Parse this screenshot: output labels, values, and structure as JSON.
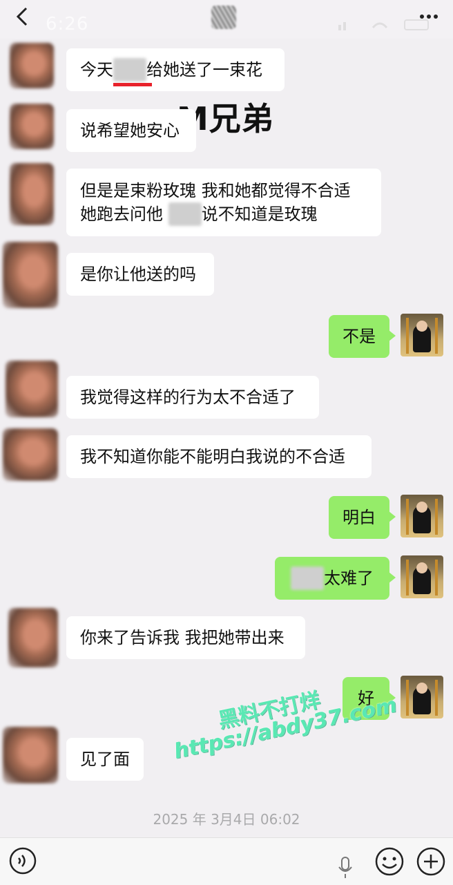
{
  "status_bar": {
    "time": "6:26"
  },
  "header": {
    "title_blurred": true
  },
  "messages": [
    {
      "side": "left",
      "pre": "今天",
      "blurred": "某某",
      "post": "给她送了一束花"
    },
    {
      "side": "left",
      "text": "说希望她安心"
    },
    {
      "side": "left",
      "line1": "但是是束粉玫瑰 我和她都觉得不合适",
      "line2_pre": "她跑去问他 ",
      "line2_blurred": "某某",
      "line2_post": "说不知道是玫瑰"
    },
    {
      "side": "left",
      "text": "是你让他送的吗"
    },
    {
      "side": "right",
      "text": "不是"
    },
    {
      "side": "left",
      "text": "我觉得这样的行为太不合适了"
    },
    {
      "side": "left",
      "text": "我不知道你能不能明白我说的不合适"
    },
    {
      "side": "right",
      "text": "明白"
    },
    {
      "side": "right",
      "blurred": "某某",
      "post": "太难了"
    },
    {
      "side": "left",
      "text": "你来了告诉我 我把她带出来"
    },
    {
      "side": "right",
      "text": "好"
    },
    {
      "side": "left",
      "text": "见了面"
    }
  ],
  "overlay": {
    "label": "M兄弟",
    "underline_color": "#e8212a"
  },
  "timestamp": "2025 年 3月4日 06:02",
  "watermark": {
    "line1": "黑料不打烊",
    "line2": "https://abdy37.com"
  },
  "input_bar": {
    "voice_icon": "voice-icon",
    "mic_icon": "microphone-icon",
    "emoji_icon": "emoji-icon",
    "plus_icon": "plus-icon"
  },
  "colors": {
    "background": "#f1eff2",
    "outgoing_bubble": "#95ec69",
    "incoming_bubble": "#ffffff"
  }
}
